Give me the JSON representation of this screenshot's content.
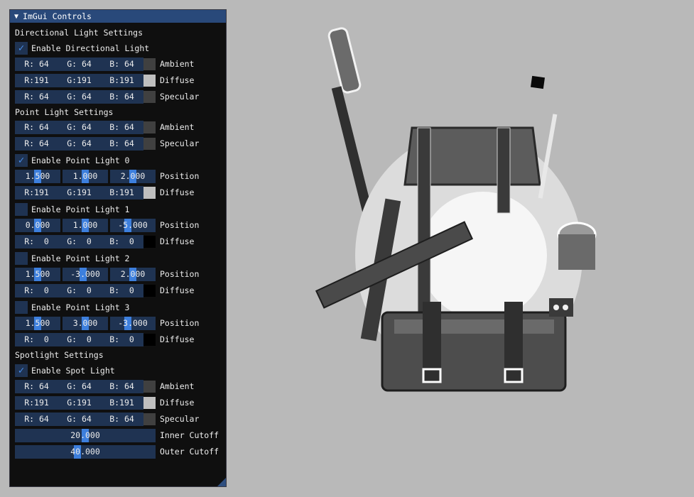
{
  "window": {
    "title": "ImGui Controls"
  },
  "colors": {
    "accent": "#3d7fdd",
    "frame_bg": "#1f3352",
    "title_bg": "#29497a",
    "viewport_bg": "#b9b9b9"
  },
  "directional": {
    "header": "Directional Light Settings",
    "enable_label": "Enable Directional Light",
    "enabled": true,
    "ambient": {
      "r": "R: 64",
      "g": "G: 64",
      "b": "B: 64",
      "label": "Ambient",
      "swatch": "#404040"
    },
    "diffuse": {
      "r": "R:191",
      "g": "G:191",
      "b": "B:191",
      "label": "Diffuse",
      "swatch": "#bfbfbf"
    },
    "specular": {
      "r": "R: 64",
      "g": "G: 64",
      "b": "B: 64",
      "label": "Specular",
      "swatch": "#404040"
    }
  },
  "point": {
    "header": "Point Light Settings",
    "ambient": {
      "r": "R: 64",
      "g": "G: 64",
      "b": "B: 64",
      "label": "Ambient",
      "swatch": "#404040"
    },
    "specular": {
      "r": "R: 64",
      "g": "G: 64",
      "b": "B: 64",
      "label": "Specular",
      "swatch": "#404040"
    },
    "lights": [
      {
        "enable_label": "Enable Point Light 0",
        "enabled": true,
        "position": {
          "x": "1.500",
          "y": "1.000",
          "z": "2.000",
          "label": "Position"
        },
        "diffuse": {
          "r": "R:191",
          "g": "G:191",
          "b": "B:191",
          "label": "Diffuse",
          "swatch": "#bfbfbf"
        }
      },
      {
        "enable_label": "Enable Point Light 1",
        "enabled": false,
        "position": {
          "x": "0.000",
          "y": "1.000",
          "z": "-5.000",
          "label": "Position"
        },
        "diffuse": {
          "r": "R:  0",
          "g": "G:  0",
          "b": "B:  0",
          "label": "Diffuse",
          "swatch": "#000000"
        }
      },
      {
        "enable_label": "Enable Point Light 2",
        "enabled": false,
        "position": {
          "x": "1.500",
          "y": "-3.000",
          "z": "2.000",
          "label": "Position"
        },
        "diffuse": {
          "r": "R:  0",
          "g": "G:  0",
          "b": "B:  0",
          "label": "Diffuse",
          "swatch": "#000000"
        }
      },
      {
        "enable_label": "Enable Point Light 3",
        "enabled": false,
        "position": {
          "x": "1.500",
          "y": "3.000",
          "z": "-3.000",
          "label": "Position"
        },
        "diffuse": {
          "r": "R:  0",
          "g": "G:  0",
          "b": "B:  0",
          "label": "Diffuse",
          "swatch": "#000000"
        }
      }
    ]
  },
  "spot": {
    "header": "Spotlight Settings",
    "enable_label": "Enable Spot Light",
    "enabled": true,
    "ambient": {
      "r": "R: 64",
      "g": "G: 64",
      "b": "B: 64",
      "label": "Ambient",
      "swatch": "#404040"
    },
    "diffuse": {
      "r": "R:191",
      "g": "G:191",
      "b": "B:191",
      "label": "Diffuse",
      "swatch": "#bfbfbf"
    },
    "specular": {
      "r": "R: 64",
      "g": "G: 64",
      "b": "B: 64",
      "label": "Specular",
      "swatch": "#404040"
    },
    "inner_cutoff": {
      "value": "20.000",
      "label": "Inner Cutoff"
    },
    "outer_cutoff": {
      "value": "40.000",
      "label": "Outer Cutoff"
    }
  },
  "icons": {
    "checkmark": "checkmark-icon",
    "collapse": "collapse-arrow-icon",
    "grip": "resize-grip-icon"
  }
}
